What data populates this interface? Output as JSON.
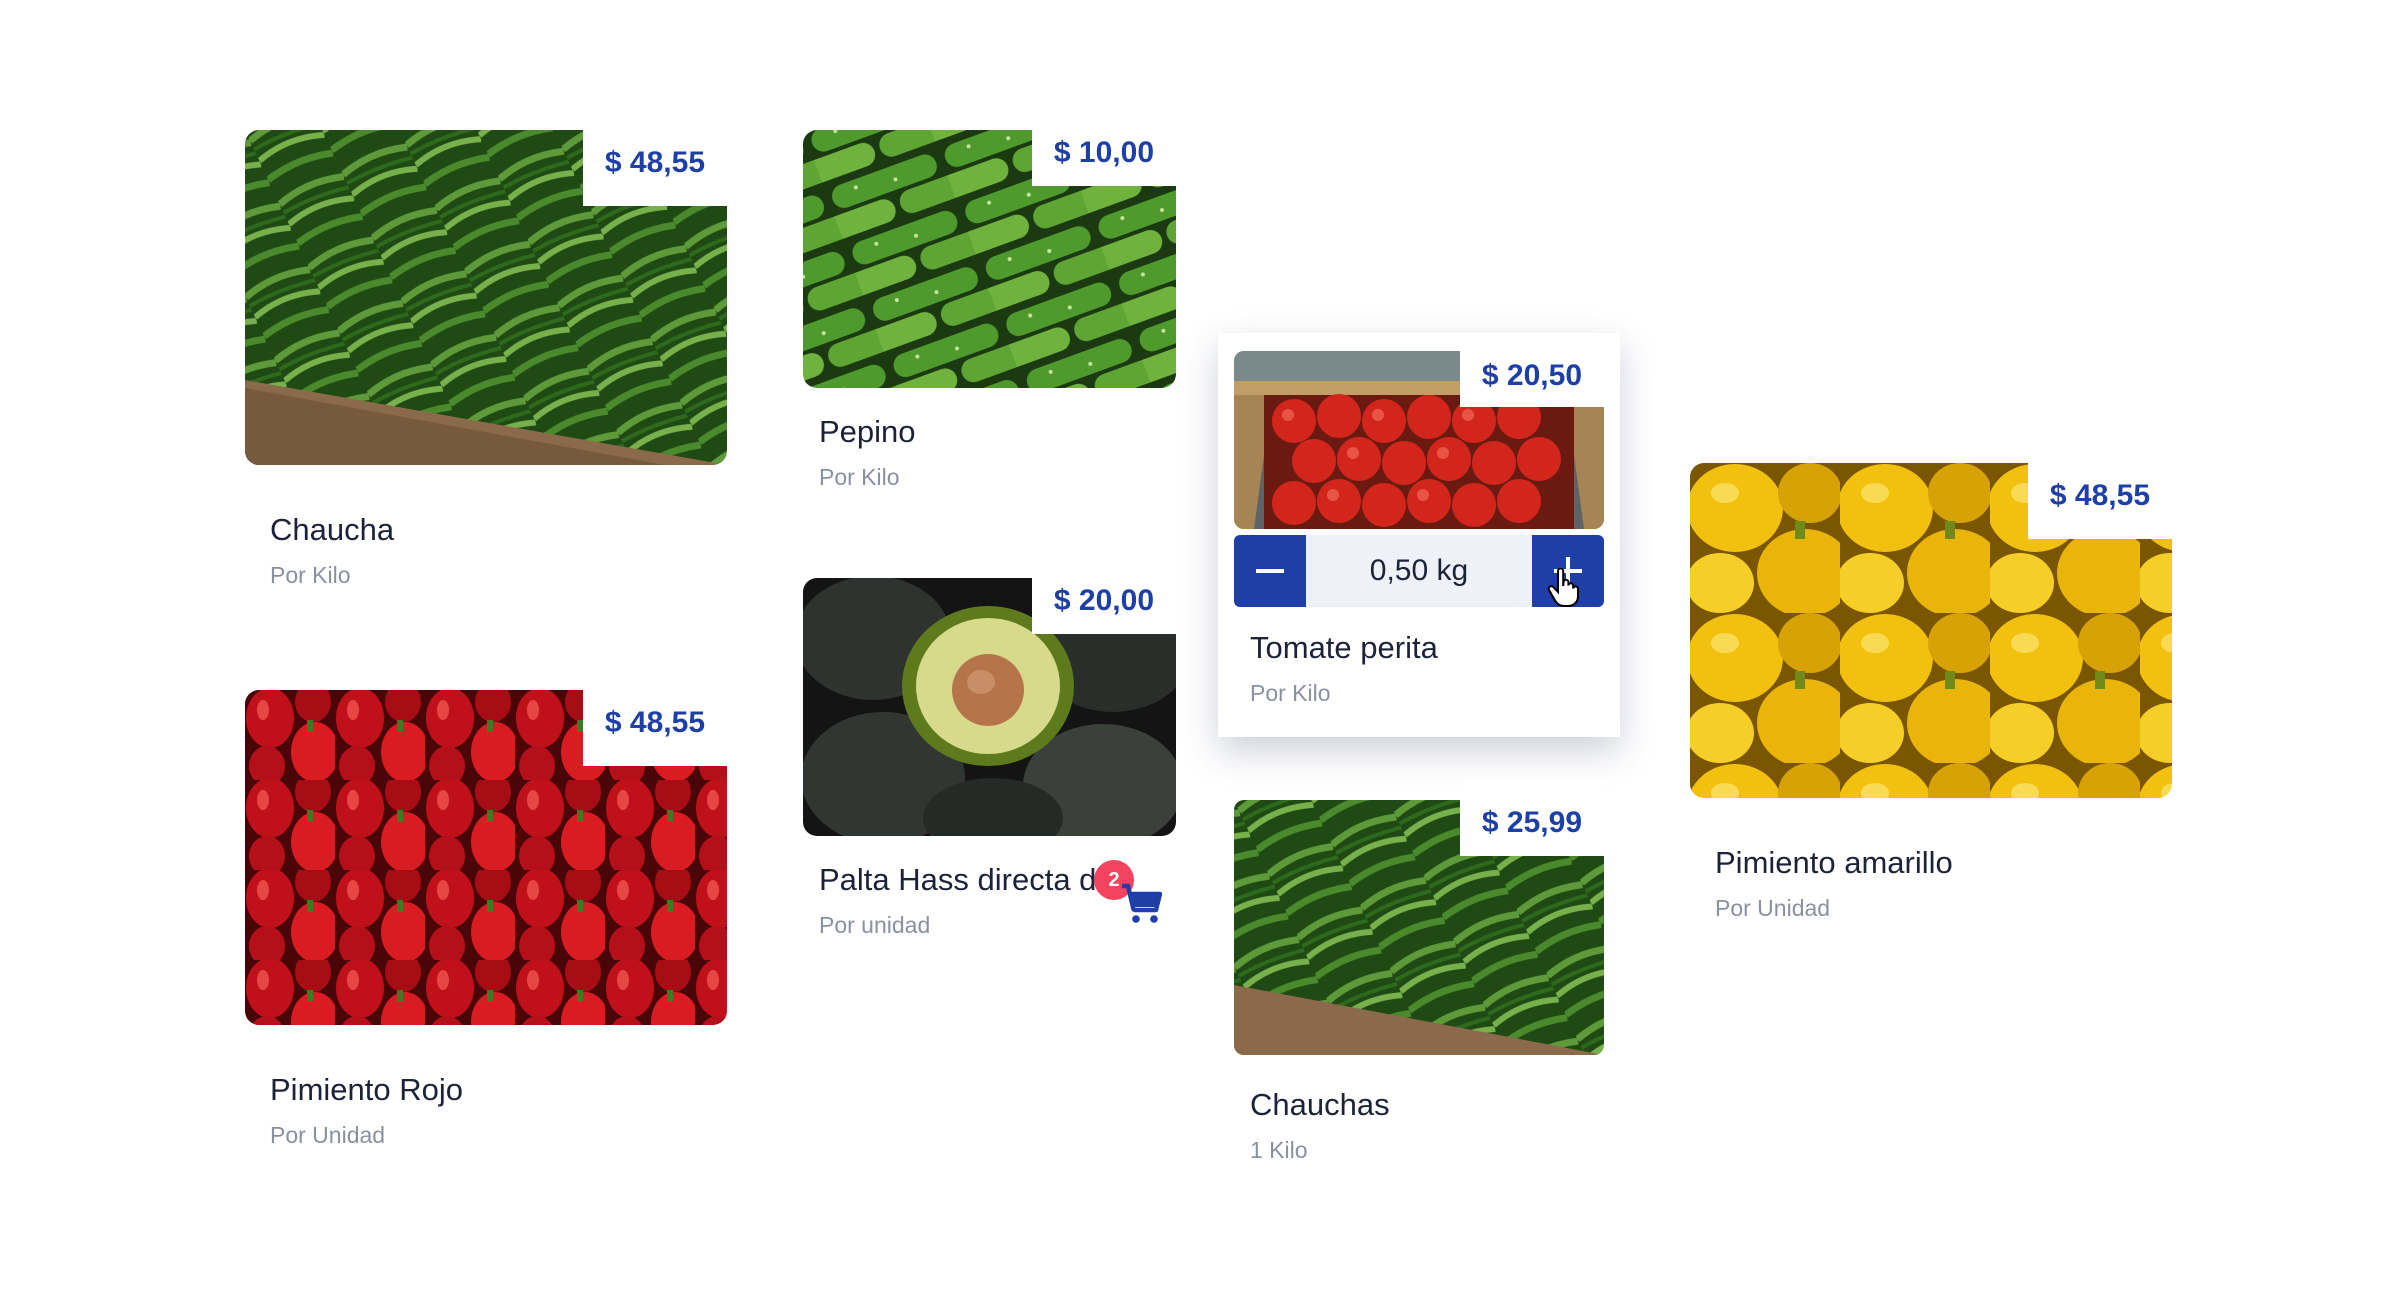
{
  "products": [
    {
      "name": "Chaucha",
      "unit": "Por Kilo",
      "price": "$ 48,55",
      "image": "green-beans"
    },
    {
      "name": "Pimiento Rojo",
      "unit": "Por Unidad",
      "price": "$ 48,55",
      "image": "red-peppers"
    },
    {
      "name": "Pepino",
      "unit": "Por Kilo",
      "price": "$ 10,00",
      "image": "cucumbers"
    },
    {
      "name": "Palta Hass directa de",
      "unit": "Por unidad",
      "price": "$ 20,00",
      "image": "avocados",
      "cart_count": "2"
    },
    {
      "name": "Tomate perita",
      "unit": "Por Kilo",
      "price": "$ 20,50",
      "image": "tomatoes",
      "quantity": "0,50 kg"
    },
    {
      "name": "Chauchas",
      "unit": "1 Kilo",
      "price": "$ 25,99",
      "image": "green-beans"
    },
    {
      "name": "Pimiento amarillo",
      "unit": "Por Unidad",
      "price": "$ 48,55",
      "image": "yellow-peppers"
    }
  ],
  "icons": {
    "minus": "minus-icon",
    "plus": "plus-icon",
    "cart": "cart-icon",
    "cursor": "hand-cursor-icon"
  },
  "colors": {
    "accent": "#1d3fa6",
    "badge": "#f4435e",
    "title": "#1c2339",
    "subtitle": "#8a90a0"
  }
}
